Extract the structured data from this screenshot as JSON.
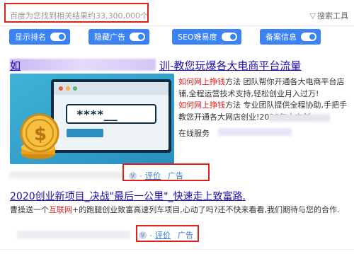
{
  "stats": {
    "text": "百度为您找到相关结果约33,300,000个"
  },
  "search_tools": {
    "label": "搜索工具"
  },
  "toggles": [
    {
      "label": "显示排名",
      "state": "on"
    },
    {
      "label": "隐藏广告",
      "state": "on"
    },
    {
      "label": "SEO难易度",
      "state": "on"
    },
    {
      "label": "备案信息",
      "state": "on"
    }
  ],
  "result1": {
    "title": "训-教您玩爆各大电商平台流量",
    "title_prefix": "如",
    "image": {
      "code_text": "****__"
    },
    "desc1_highlight": "如何网上挣钱",
    "desc1_rest": "方法 团队帮你开通各大电商平台店铺,全程运营技术支持,轻松创业月入过万!",
    "desc2_highlight": "如何网上挣钱",
    "desc2_rest": "方法 专业团队提供全程协助,手把手教您开通各大网店创业!2020年小本创...",
    "site_label": "在线服务",
    "meta": {
      "separator": "-",
      "review": "评价",
      "ad": "广告"
    }
  },
  "result2": {
    "title": "2020创业新项目_决战\"最后一公里\"_快速走上致富路.",
    "desc_prefix": "曹操送一个",
    "desc_highlight": "互联网",
    "desc_rest": "+的跑腿创业致富高速列车项目,心动了吗?还不快来看看,我们期待与您的合作.",
    "meta": {
      "separator": "-",
      "review": "评价",
      "ad": "广告"
    }
  },
  "colors": {
    "accent_blue": "#3b82f6",
    "highlight_red": "#e0201c",
    "link_blue": "#1a0dab"
  }
}
